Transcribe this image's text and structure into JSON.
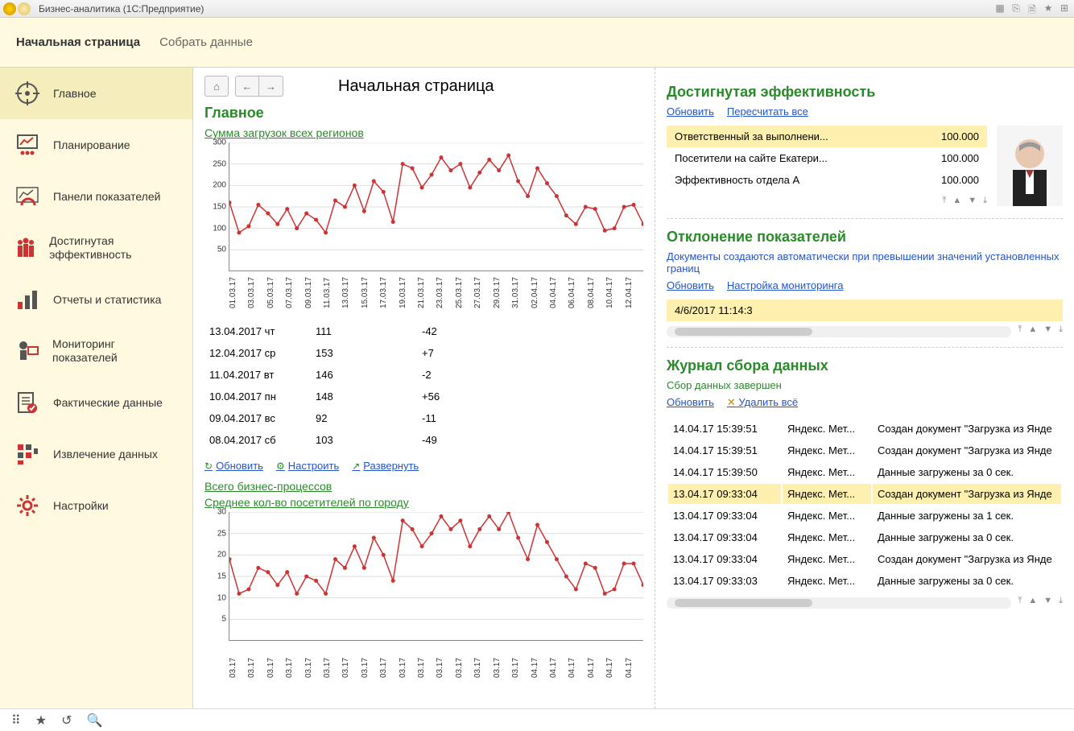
{
  "window": {
    "title": "Бизнес-аналитика  (1С:Предприятие)"
  },
  "topmenu": {
    "items": [
      "Начальная страница",
      "Собрать данные"
    ],
    "active": 0
  },
  "sidebar": {
    "items": [
      {
        "label": "Главное"
      },
      {
        "label": "Планирование"
      },
      {
        "label": "Панели показателей"
      },
      {
        "label": "Достигнутая эффективность"
      },
      {
        "label": "Отчеты и статистика"
      },
      {
        "label": "Мониторинг показателей"
      },
      {
        "label": "Фактические данные"
      },
      {
        "label": "Извлечение данных"
      },
      {
        "label": "Настройки"
      }
    ],
    "active": 0
  },
  "page": {
    "title": "Начальная страница"
  },
  "left": {
    "heading": "Главное",
    "chart1_title": "Сумма загрузок всех регионов",
    "chart2_title": "Среднее кол-во посетителей по городу",
    "chart3_title": "Всего бизнес-процессов",
    "actions": {
      "refresh": "Обновить",
      "configure": "Настроить",
      "expand": "Развернуть"
    },
    "table": [
      {
        "date": "13.04.2017 чт",
        "v1": "111",
        "v2": "-42"
      },
      {
        "date": "12.04.2017 ср",
        "v1": "153",
        "v2": "+7"
      },
      {
        "date": "11.04.2017 вт",
        "v1": "146",
        "v2": "-2"
      },
      {
        "date": "10.04.2017 пн",
        "v1": "148",
        "v2": "+56"
      },
      {
        "date": "09.04.2017 вс",
        "v1": "92",
        "v2": "-11"
      },
      {
        "date": "08.04.2017 сб",
        "v1": "103",
        "v2": "-49"
      }
    ]
  },
  "chart_data": [
    {
      "type": "line",
      "title": "Сумма загрузок всех регионов",
      "ylim": [
        0,
        300
      ],
      "yticks": [
        50,
        100,
        150,
        200,
        250,
        300
      ],
      "categories": [
        "01.03.17",
        "03.03.17",
        "05.03.17",
        "07.03.17",
        "09.03.17",
        "11.03.17",
        "13.03.17",
        "15.03.17",
        "17.03.17",
        "19.03.17",
        "21.03.17",
        "23.03.17",
        "25.03.17",
        "27.03.17",
        "29.03.17",
        "31.03.17",
        "02.04.17",
        "04.04.17",
        "06.04.17",
        "08.04.17",
        "10.04.17",
        "12.04.17"
      ],
      "values": [
        160,
        90,
        105,
        155,
        135,
        110,
        145,
        100,
        135,
        120,
        90,
        165,
        150,
        200,
        140,
        210,
        185,
        115,
        250,
        240,
        195,
        225,
        265,
        235,
        250,
        195,
        230,
        260,
        235,
        270,
        210,
        175,
        240,
        205,
        175,
        130,
        110,
        150,
        145,
        95,
        100,
        150,
        155,
        110
      ]
    },
    {
      "type": "line",
      "title": "Среднее кол-во посетителей по городу",
      "ylim": [
        0,
        30
      ],
      "yticks": [
        5,
        10,
        15,
        20,
        25,
        30
      ],
      "categories": [
        "03.17",
        "03.17",
        "03.17",
        "03.17",
        "03.17",
        "03.17",
        "03.17",
        "03.17",
        "03.17",
        "03.17",
        "03.17",
        "03.17",
        "03.17",
        "03.17",
        "03.17",
        "03.17",
        "04.17",
        "04.17",
        "04.17",
        "04.17",
        "04.17",
        "04.17"
      ],
      "values": [
        19,
        11,
        12,
        17,
        16,
        13,
        16,
        11,
        15,
        14,
        11,
        19,
        17,
        22,
        17,
        24,
        20,
        14,
        28,
        26,
        22,
        25,
        29,
        26,
        28,
        22,
        26,
        29,
        26,
        30,
        24,
        19,
        27,
        23,
        19,
        15,
        12,
        18,
        17,
        11,
        12,
        18,
        18,
        13
      ]
    }
  ],
  "right": {
    "eff": {
      "heading": "Достигнутая эффективность",
      "links": {
        "refresh": "Обновить",
        "recalc": "Пересчитать все"
      },
      "rows": [
        {
          "name": "Ответственный за выполнени...",
          "val": "100.000",
          "hl": true
        },
        {
          "name": "Посетители на сайте Екатери...",
          "val": "100.000"
        },
        {
          "name": "Эффективность отдела А",
          "val": "100.000"
        }
      ]
    },
    "dev": {
      "heading": "Отклонение показателей",
      "desc": "Документы создаются автоматически при превышении значений установленных границ",
      "links": {
        "refresh": "Обновить",
        "config": "Настройка мониторинга"
      },
      "row_preview": "4/6/2017 11:14:3"
    },
    "log": {
      "heading": "Журнал сбора данных",
      "status": "Сбор данных завершен",
      "links": {
        "refresh": "Обновить",
        "delete": "Удалить всё"
      },
      "rows": [
        {
          "t": "14.04.17 15:39:51",
          "src": "Яндекс. Мет...",
          "msg": "Создан документ \"Загрузка из Янде"
        },
        {
          "t": "14.04.17 15:39:51",
          "src": "Яндекс. Мет...",
          "msg": "Создан документ \"Загрузка из Янде"
        },
        {
          "t": "14.04.17 15:39:50",
          "src": "Яндекс. Мет...",
          "msg": "Данные загружены за 0 сек."
        },
        {
          "t": "13.04.17 09:33:04",
          "src": "Яндекс. Мет...",
          "msg": "Создан документ \"Загрузка из Янде",
          "hl": true
        },
        {
          "t": "13.04.17 09:33:04",
          "src": "Яндекс. Мет...",
          "msg": "Данные загружены за 1 сек."
        },
        {
          "t": "13.04.17 09:33:04",
          "src": "Яндекс. Мет...",
          "msg": "Данные загружены за 0 сек."
        },
        {
          "t": "13.04.17 09:33:04",
          "src": "Яндекс. Мет...",
          "msg": "Создан документ \"Загрузка из Янде"
        },
        {
          "t": "13.04.17 09:33:03",
          "src": "Яндекс. Мет...",
          "msg": "Данные загружены за 0 сек."
        }
      ]
    }
  }
}
